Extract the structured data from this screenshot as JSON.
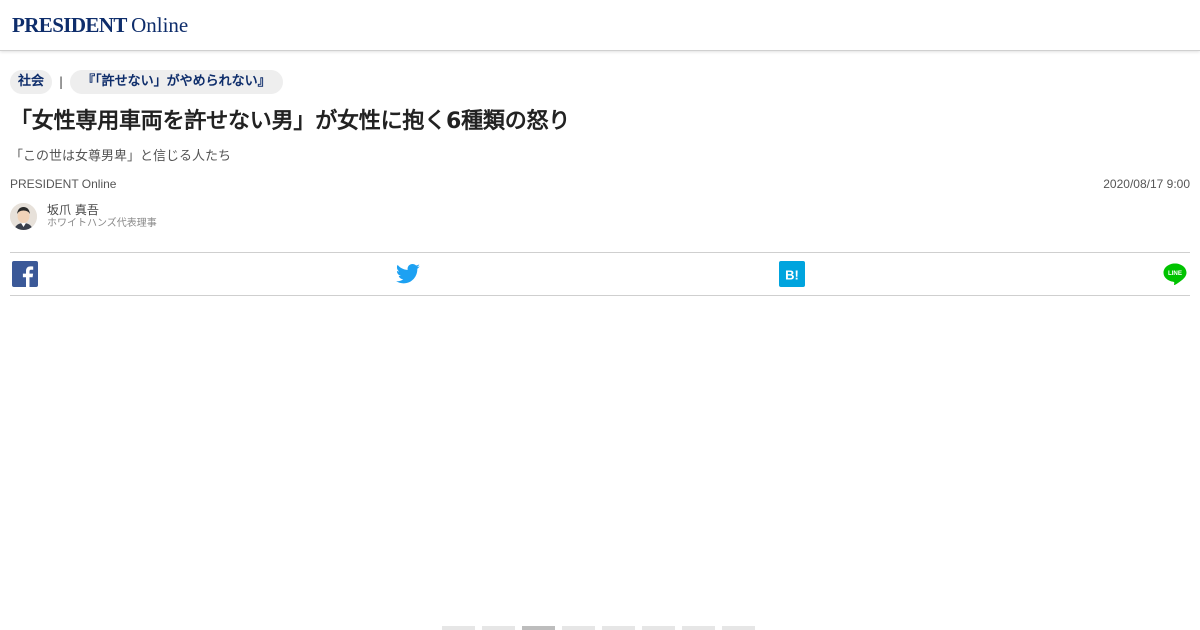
{
  "header": {
    "logo_main": "PRESIDENT",
    "logo_sub": "Online"
  },
  "breadcrumb": {
    "category": "社会",
    "separator": "|",
    "series": "『「許せない」がやめられない』"
  },
  "article": {
    "title": "「女性専用車両を許せない男」が女性に抱く6種類の怒り",
    "subtitle": "「この世は女尊男卑」と信じる人たち",
    "publisher": "PRESIDENT Online",
    "date": "2020/08/17 9:00",
    "author_name": "坂爪 真吾",
    "author_role": "ホワイトハンズ代表理事"
  },
  "share": [
    {
      "service": "facebook",
      "icon": "facebook-icon",
      "color": "#3b5998"
    },
    {
      "service": "twitter",
      "icon": "twitter-icon",
      "color": "#1da1f2"
    },
    {
      "service": "hatena",
      "icon": "hatena-bookmark-icon",
      "color": "#00a4de",
      "label": "B!"
    },
    {
      "service": "line",
      "icon": "line-icon",
      "color": "#00c300",
      "label": "LINE"
    }
  ],
  "pagination": {
    "total_pages": 8,
    "current_page": 3
  }
}
